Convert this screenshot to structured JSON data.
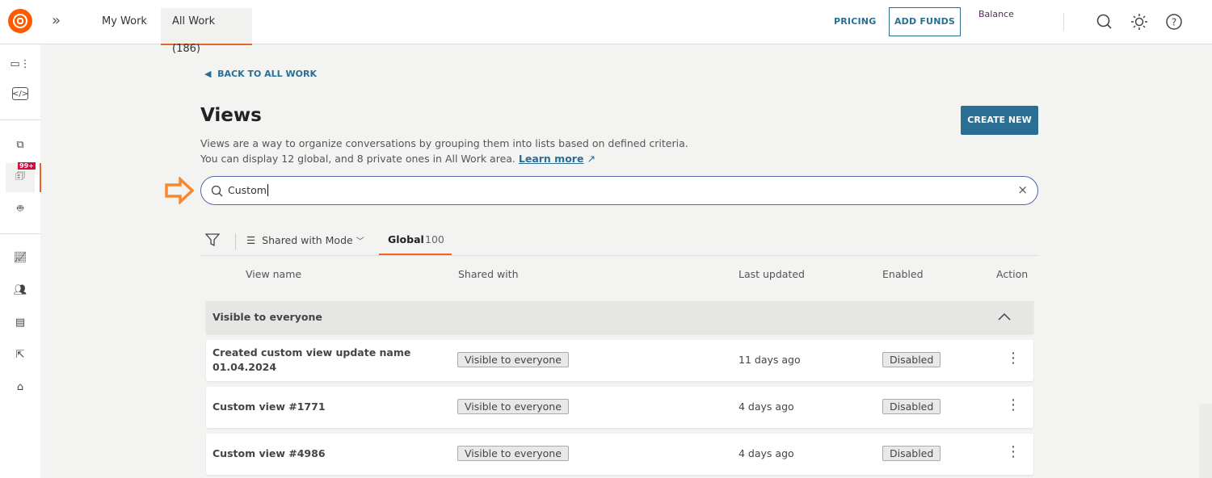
{
  "header": {
    "tabs": [
      {
        "label": "My Work"
      },
      {
        "label": "All Work (186)"
      }
    ],
    "pricing": "PRICING",
    "add_funds": "ADD FUNDS",
    "balance": "Balance"
  },
  "badge": "99+",
  "page": {
    "back": "BACK TO ALL WORK",
    "title": "Views",
    "desc1": "Views are a way to organize conversations by grouping them into lists based on defined criteria.",
    "desc2": "You can display 12 global, and 8 private ones in All Work area.",
    "learn_more": "Learn more",
    "create_new": "CREATE NEW"
  },
  "search": {
    "value": "Custom"
  },
  "filters": {
    "group_by": "Shared with Mode",
    "tab_label": "Global",
    "tab_count": "100"
  },
  "table": {
    "columns": [
      "View name",
      "Shared with",
      "Last updated",
      "Enabled",
      "Action"
    ],
    "group": "Visible to everyone",
    "rows": [
      {
        "name": "Created custom view update name 01.04.2024",
        "shared": "Visible to everyone",
        "updated": "11 days ago",
        "enabled": "Disabled"
      },
      {
        "name": "Custom view #1771",
        "shared": "Visible to everyone",
        "updated": "4 days ago",
        "enabled": "Disabled"
      },
      {
        "name": "Custom view #4986",
        "shared": "Visible to everyone",
        "updated": "4 days ago",
        "enabled": "Disabled"
      }
    ]
  },
  "colors": {
    "brand": "#ff5a00",
    "accent": "#2a6f93",
    "arrow": "#f7882f"
  }
}
